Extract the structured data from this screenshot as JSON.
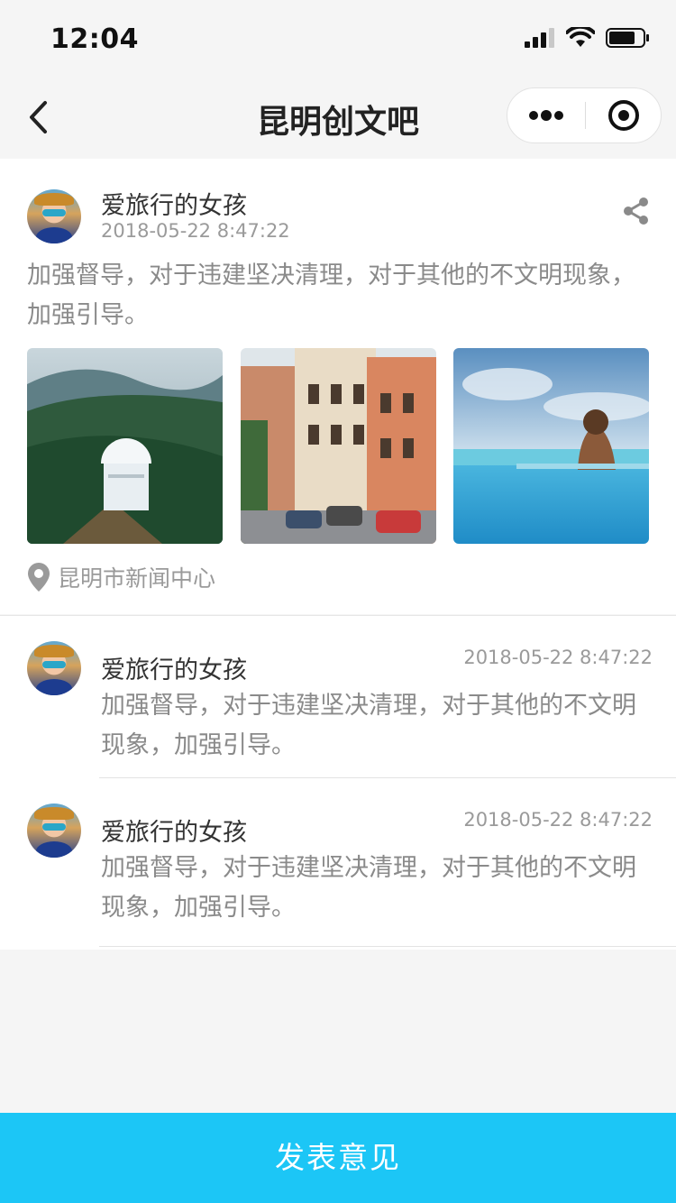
{
  "status": {
    "time": "12:04"
  },
  "nav": {
    "title": "昆明创文吧"
  },
  "post": {
    "author": "爱旅行的女孩",
    "timestamp": "2018-05-22 8:47:22",
    "content": "加强督导，对于违建坚决清理，对于其他的不文明现象，加强引导。",
    "images": [
      "observatory-forest-photo",
      "old-town-street-photo",
      "infinity-pool-photo"
    ],
    "location": "昆明市新闻中心"
  },
  "comments": [
    {
      "author": "爱旅行的女孩",
      "timestamp": "2018-05-22 8:47:22",
      "content": "加强督导，对于违建坚决清理，对于其他的不文明现象，加强引导。"
    },
    {
      "author": "爱旅行的女孩",
      "timestamp": "2018-05-22 8:47:22",
      "content": "加强督导，对于违建坚决清理，对于其他的不文明现象，加强引导。"
    }
  ],
  "footer": {
    "button_label": "发表意见"
  },
  "colors": {
    "accent": "#1cc6f6",
    "background": "#f5f5f5",
    "muted_text": "#8a8a8a"
  }
}
